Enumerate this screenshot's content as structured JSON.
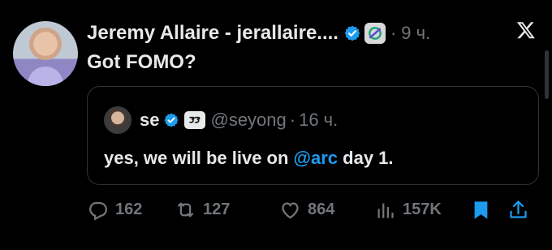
{
  "post": {
    "author_name": "Jeremy Allaire - jerallaire....",
    "time": "9 ч.",
    "separator": "·",
    "text": "Got FOMO?",
    "icons": {
      "verified": "verified-badge-icon",
      "affiliate": "circle-affiliate-icon",
      "platform": "x-logo-icon"
    }
  },
  "quote": {
    "name": "se",
    "handle": "@seyong",
    "separator": "·",
    "time": "16 ч.",
    "text_before": "yes, we will be live on ",
    "mention": "@arc",
    "text_after": " day 1."
  },
  "actions": {
    "replies": "162",
    "reposts": "127",
    "likes": "864",
    "views": "157K"
  },
  "colors": {
    "background": "#000000",
    "text": "#e7e9ea",
    "muted": "#71767b",
    "accent": "#1d9bf0",
    "border": "#2f3336"
  }
}
